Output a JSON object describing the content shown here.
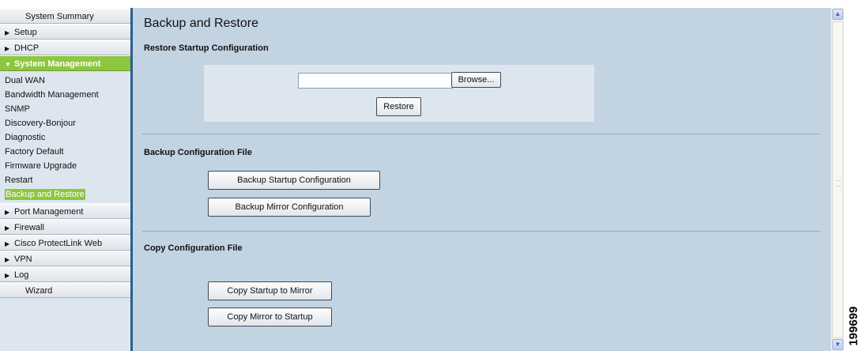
{
  "sidebar": {
    "top_items": [
      {
        "label": "System Summary",
        "arrow": false
      },
      {
        "label": "Setup",
        "arrow": true
      },
      {
        "label": "DHCP",
        "arrow": true
      }
    ],
    "active_section": {
      "label": "System Management"
    },
    "sub_items": [
      {
        "label": "Dual WAN"
      },
      {
        "label": "Bandwidth Management"
      },
      {
        "label": "SNMP"
      },
      {
        "label": "Discovery-Bonjour"
      },
      {
        "label": "Diagnostic"
      },
      {
        "label": "Factory Default"
      },
      {
        "label": "Firmware Upgrade"
      },
      {
        "label": "Restart"
      },
      {
        "label": "Backup and Restore",
        "selected": true
      }
    ],
    "bottom_items": [
      {
        "label": "Port Management"
      },
      {
        "label": "Firewall"
      },
      {
        "label": "Cisco ProtectLink Web"
      },
      {
        "label": "VPN"
      },
      {
        "label": "Log"
      },
      {
        "label": "Wizard"
      }
    ]
  },
  "main": {
    "title": "Backup and Restore",
    "restore_section": {
      "heading": "Restore Startup Configuration",
      "file_value": "",
      "browse_label": "Browse...",
      "restore_label": "Restore"
    },
    "backup_section": {
      "heading": "Backup Configuration File",
      "backup_startup_label": "Backup Startup Configuration",
      "backup_mirror_label": "Backup Mirror Configuration"
    },
    "copy_section": {
      "heading": "Copy Configuration File",
      "copy_startup_label": "Copy Startup to Mirror",
      "copy_mirror_label": "Copy Mirror to Startup"
    }
  },
  "figure_id": "199699",
  "colors": {
    "accent_green": "#8dc63f",
    "main_bg": "#c2d3e2",
    "sidebar_bg": "#dde6ef",
    "divider_blue": "#2c5e8e"
  }
}
